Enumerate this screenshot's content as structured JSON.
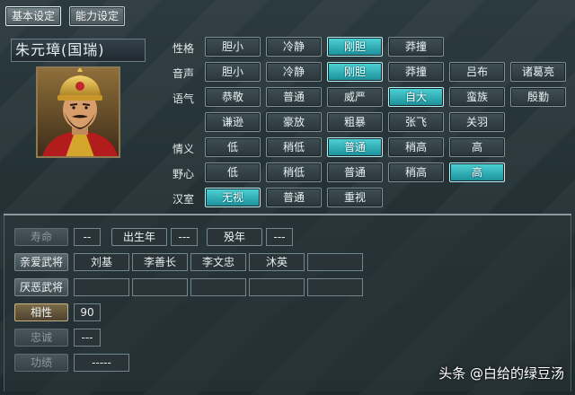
{
  "tabs": [
    {
      "label": "基本设定",
      "active": true
    },
    {
      "label": "能力设定",
      "active": false
    }
  ],
  "officer": {
    "name": "朱元璋(国瑞)"
  },
  "traits": {
    "personality": {
      "label": "性格",
      "options": [
        "胆小",
        "冷静",
        "刚胆",
        "莽撞"
      ],
      "selected": "刚胆"
    },
    "voice": {
      "label": "音声",
      "options": [
        "胆小",
        "冷静",
        "刚胆",
        "莽撞",
        "吕布",
        "诸葛亮"
      ],
      "selected": "刚胆"
    },
    "tone": {
      "label": "语气",
      "options_row1": [
        "恭敬",
        "普通",
        "威严",
        "自大",
        "蛮族",
        "殷勤"
      ],
      "options_row2": [
        "谦逊",
        "豪放",
        "粗暴",
        "张飞",
        "关羽"
      ],
      "selected": "自大"
    },
    "loyalty_feel": {
      "label": "情义",
      "options": [
        "低",
        "稍低",
        "普通",
        "稍高",
        "高"
      ],
      "selected": "普通"
    },
    "ambition": {
      "label": "野心",
      "options": [
        "低",
        "稍低",
        "普通",
        "稍高",
        "高"
      ],
      "selected": "高"
    },
    "han": {
      "label": "汉室",
      "options": [
        "无视",
        "普通",
        "重视"
      ],
      "selected": "无视"
    }
  },
  "info": {
    "lifespan_label": "寿命",
    "lifespan_value": "--",
    "birth_label": "出生年",
    "birth_value": "---",
    "death_label": "殁年",
    "death_value": "---",
    "favored_label": "亲爱武将",
    "favored": [
      "刘基",
      "李善长",
      "李文忠",
      "沐英",
      ""
    ],
    "disliked_label": "厌恶武将",
    "disliked": [
      "",
      "",
      "",
      "",
      ""
    ],
    "compat_label": "相性",
    "compat_value": "90",
    "loyalty_label": "忠诚",
    "loyalty_value": "---",
    "merit_label": "功绩",
    "merit_value": "-----"
  },
  "watermark": "头条 @白给的绿豆汤",
  "colors": {
    "selected": "#2fb7bd",
    "button": "#3a484d",
    "background": "#243236"
  }
}
